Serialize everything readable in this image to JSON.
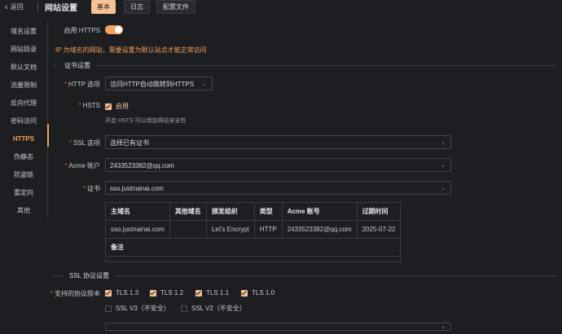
{
  "header": {
    "back_label": "返回",
    "title": "网站设置",
    "tabs": [
      {
        "label": "基本",
        "active": true
      },
      {
        "label": "日志",
        "active": false
      },
      {
        "label": "配置文件",
        "active": false
      }
    ]
  },
  "sidebar": {
    "items": [
      {
        "label": "域名设置",
        "active": false
      },
      {
        "label": "网站目录",
        "active": false
      },
      {
        "label": "默认文档",
        "active": false
      },
      {
        "label": "流量限制",
        "active": false
      },
      {
        "label": "反向代理",
        "active": false
      },
      {
        "label": "密码访问",
        "active": false
      },
      {
        "label": "HTTPS",
        "active": true
      },
      {
        "label": "伪静态",
        "active": false
      },
      {
        "label": "防盗链",
        "active": false
      },
      {
        "label": "重定向",
        "active": false
      },
      {
        "label": "其他",
        "active": false
      }
    ]
  },
  "https": {
    "enable_label": "启用 HTTPS",
    "enabled": true,
    "warning": "IP 为域名的网站，需要设置为默认站点才能正常访问"
  },
  "cert_section": {
    "title": "证书设置",
    "http_option_label": "HTTP 选项",
    "http_option_value": "访问HTTP自动跳转到HTTPS",
    "hsts_label": "HSTS",
    "hsts_check_label": "启用",
    "hsts_hint": "开启 HSTS 可以增加网站安全性",
    "ssl_option_label": "SSL 选项",
    "ssl_option_value": "选择已有证书",
    "acme_label": "Acme 账户",
    "acme_value": "2433523382@qq.com",
    "cert_label": "证书",
    "cert_value": "sso.justnainai.com",
    "table": {
      "headers": [
        "主域名",
        "其他域名",
        "颁发组织",
        "类型",
        "Acme 账号",
        "过期时间"
      ],
      "row": [
        "sso.justnainai.com",
        "",
        "Let's Encrypt",
        "HTTP",
        "2433523382@qq.com",
        "2025-07-22"
      ],
      "remark_header": "备注"
    }
  },
  "ssl_section": {
    "title": "SSL 协议设置",
    "protocols_label": "支持的协议版本",
    "protocols": [
      {
        "label": "TLS 1.3",
        "checked": true
      },
      {
        "label": "TLS 1.2",
        "checked": true
      },
      {
        "label": "TLS 1.1",
        "checked": true
      },
      {
        "label": "TLS 1.0",
        "checked": true
      },
      {
        "label": "SSL V3（不安全）",
        "checked": false
      },
      {
        "label": "SSL V2（不安全）",
        "checked": false
      }
    ]
  },
  "colors": {
    "accent": "#f5a25a",
    "tab_active": "#f5c297",
    "background": "#1d1e22",
    "required": "#e2574c"
  }
}
